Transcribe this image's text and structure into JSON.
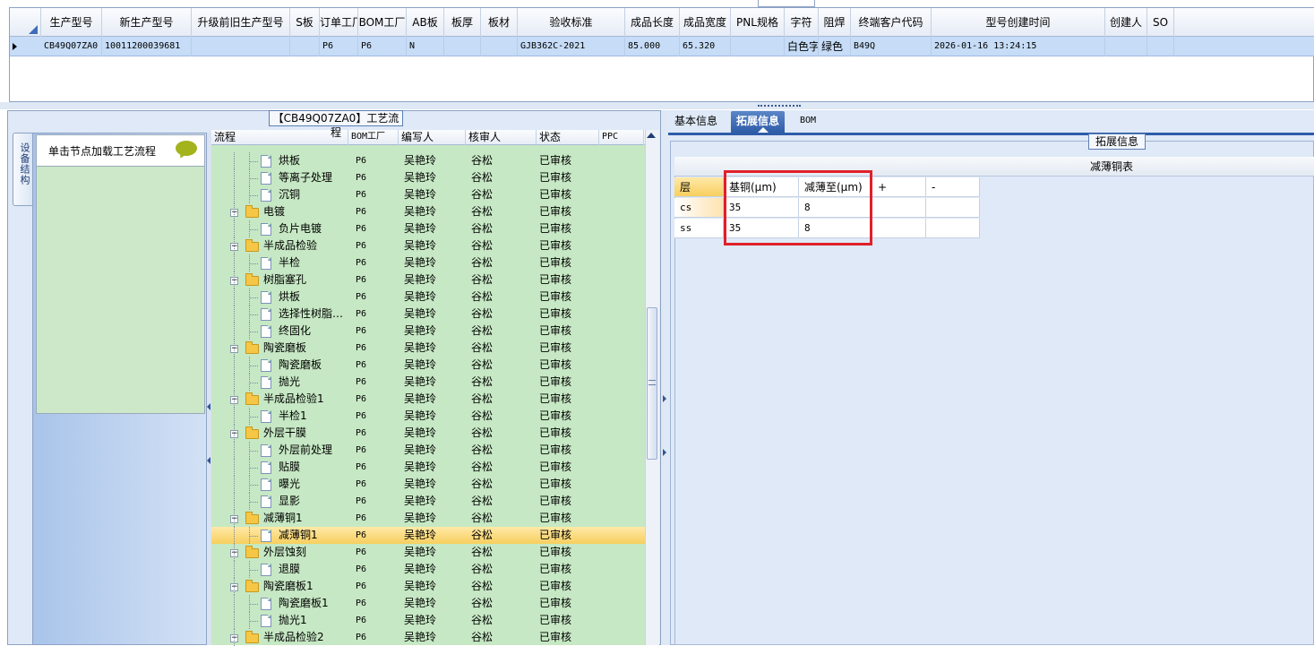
{
  "top_grid": {
    "columns": [
      "生产型号",
      "新生产型号",
      "升级前旧生产型号",
      "S板",
      "订单工厂",
      "BOM工厂",
      "AB板",
      "板厚",
      "板材",
      "验收标准",
      "成品长度",
      "成品宽度",
      "PNL规格",
      "字符",
      "阻焊",
      "终端客户代码",
      "型号创建时间",
      "创建人",
      "SO"
    ],
    "row": [
      "CB49Q07ZA0",
      "10011200039681",
      "",
      "",
      "P6",
      "P6",
      "N",
      "",
      "",
      "GJB362C-2021",
      "85.000",
      "65.320",
      "",
      "白色字符",
      "绿色",
      "B49Q",
      "2026-01-16 13:24:15",
      "",
      ""
    ]
  },
  "left_panel": {
    "title": "【CB49Q07ZA0】工艺流程",
    "vertical_tab": "设备结构",
    "nav_hint": "单击节点加载工艺流程",
    "tree_columns": [
      "流程",
      "BOM工厂",
      "编写人",
      "核审人",
      "状态",
      "PPC"
    ],
    "rows": [
      {
        "name": "烘板",
        "type": "file",
        "bom": "P6",
        "writer": "吴艳玲",
        "reviewer": "谷松",
        "status": "已审核"
      },
      {
        "name": "等离子处理",
        "type": "file",
        "bom": "P6",
        "writer": "吴艳玲",
        "reviewer": "谷松",
        "status": "已审核"
      },
      {
        "name": "沉铜",
        "type": "file",
        "bom": "P6",
        "writer": "吴艳玲",
        "reviewer": "谷松",
        "status": "已审核"
      },
      {
        "name": "电镀",
        "type": "folder",
        "bom": "P6",
        "writer": "吴艳玲",
        "reviewer": "谷松",
        "status": "已审核"
      },
      {
        "name": "负片电镀",
        "type": "file",
        "bom": "P6",
        "writer": "吴艳玲",
        "reviewer": "谷松",
        "status": "已审核"
      },
      {
        "name": "半成品检验",
        "type": "folder",
        "bom": "P6",
        "writer": "吴艳玲",
        "reviewer": "谷松",
        "status": "已审核"
      },
      {
        "name": "半检",
        "type": "file",
        "bom": "P6",
        "writer": "吴艳玲",
        "reviewer": "谷松",
        "status": "已审核"
      },
      {
        "name": "树脂塞孔",
        "type": "folder",
        "bom": "P6",
        "writer": "吴艳玲",
        "reviewer": "谷松",
        "status": "已审核"
      },
      {
        "name": "烘板",
        "type": "file",
        "bom": "P6",
        "writer": "吴艳玲",
        "reviewer": "谷松",
        "status": "已审核"
      },
      {
        "name": "选择性树脂…",
        "type": "file",
        "bom": "P6",
        "writer": "吴艳玲",
        "reviewer": "谷松",
        "status": "已审核"
      },
      {
        "name": "终固化",
        "type": "file",
        "bom": "P6",
        "writer": "吴艳玲",
        "reviewer": "谷松",
        "status": "已审核"
      },
      {
        "name": "陶瓷磨板",
        "type": "folder",
        "bom": "P6",
        "writer": "吴艳玲",
        "reviewer": "谷松",
        "status": "已审核"
      },
      {
        "name": "陶瓷磨板",
        "type": "file",
        "bom": "P6",
        "writer": "吴艳玲",
        "reviewer": "谷松",
        "status": "已审核"
      },
      {
        "name": "抛光",
        "type": "file",
        "bom": "P6",
        "writer": "吴艳玲",
        "reviewer": "谷松",
        "status": "已审核"
      },
      {
        "name": "半成品检验1",
        "type": "folder",
        "bom": "P6",
        "writer": "吴艳玲",
        "reviewer": "谷松",
        "status": "已审核"
      },
      {
        "name": "半检1",
        "type": "file",
        "bom": "P6",
        "writer": "吴艳玲",
        "reviewer": "谷松",
        "status": "已审核"
      },
      {
        "name": "外层干膜",
        "type": "folder",
        "bom": "P6",
        "writer": "吴艳玲",
        "reviewer": "谷松",
        "status": "已审核"
      },
      {
        "name": "外层前处理",
        "type": "file",
        "bom": "P6",
        "writer": "吴艳玲",
        "reviewer": "谷松",
        "status": "已审核"
      },
      {
        "name": "贴膜",
        "type": "file",
        "bom": "P6",
        "writer": "吴艳玲",
        "reviewer": "谷松",
        "status": "已审核"
      },
      {
        "name": "曝光",
        "type": "file",
        "bom": "P6",
        "writer": "吴艳玲",
        "reviewer": "谷松",
        "status": "已审核"
      },
      {
        "name": "显影",
        "type": "file",
        "bom": "P6",
        "writer": "吴艳玲",
        "reviewer": "谷松",
        "status": "已审核"
      },
      {
        "name": "减薄铜1",
        "type": "folder",
        "bom": "P6",
        "writer": "吴艳玲",
        "reviewer": "谷松",
        "status": "已审核"
      },
      {
        "name": "减薄铜1",
        "type": "file",
        "bom": "P6",
        "writer": "吴艳玲",
        "reviewer": "谷松",
        "status": "已审核",
        "selected": true
      },
      {
        "name": "外层蚀刻",
        "type": "folder",
        "bom": "P6",
        "writer": "吴艳玲",
        "reviewer": "谷松",
        "status": "已审核"
      },
      {
        "name": "退膜",
        "type": "file",
        "bom": "P6",
        "writer": "吴艳玲",
        "reviewer": "谷松",
        "status": "已审核"
      },
      {
        "name": "陶瓷磨板1",
        "type": "folder",
        "bom": "P6",
        "writer": "吴艳玲",
        "reviewer": "谷松",
        "status": "已审核"
      },
      {
        "name": "陶瓷磨板1",
        "type": "file",
        "bom": "P6",
        "writer": "吴艳玲",
        "reviewer": "谷松",
        "status": "已审核"
      },
      {
        "name": "抛光1",
        "type": "file",
        "bom": "P6",
        "writer": "吴艳玲",
        "reviewer": "谷松",
        "status": "已审核"
      },
      {
        "name": "半成品检验2",
        "type": "folder",
        "bom": "P6",
        "writer": "吴艳玲",
        "reviewer": "谷松",
        "status": "已审核"
      }
    ]
  },
  "right_panel": {
    "tabs": [
      "基本信息",
      "拓展信息",
      "BOM"
    ],
    "active_tab": "拓展信息",
    "group_title": "拓展信息",
    "table_title": "减薄铜表",
    "table_columns": [
      "层",
      "基铜(μm)",
      "减薄至(μm)",
      "+",
      "-"
    ],
    "table_rows": [
      [
        "cs",
        "35",
        "8",
        "",
        ""
      ],
      [
        "ss",
        "35",
        "8",
        "",
        ""
      ]
    ]
  },
  "colors": {
    "accent": "#2e5ca8",
    "tree_bg": "#c6e8c4",
    "selection": "#c6dcf7",
    "highlight": "#e0202a"
  }
}
